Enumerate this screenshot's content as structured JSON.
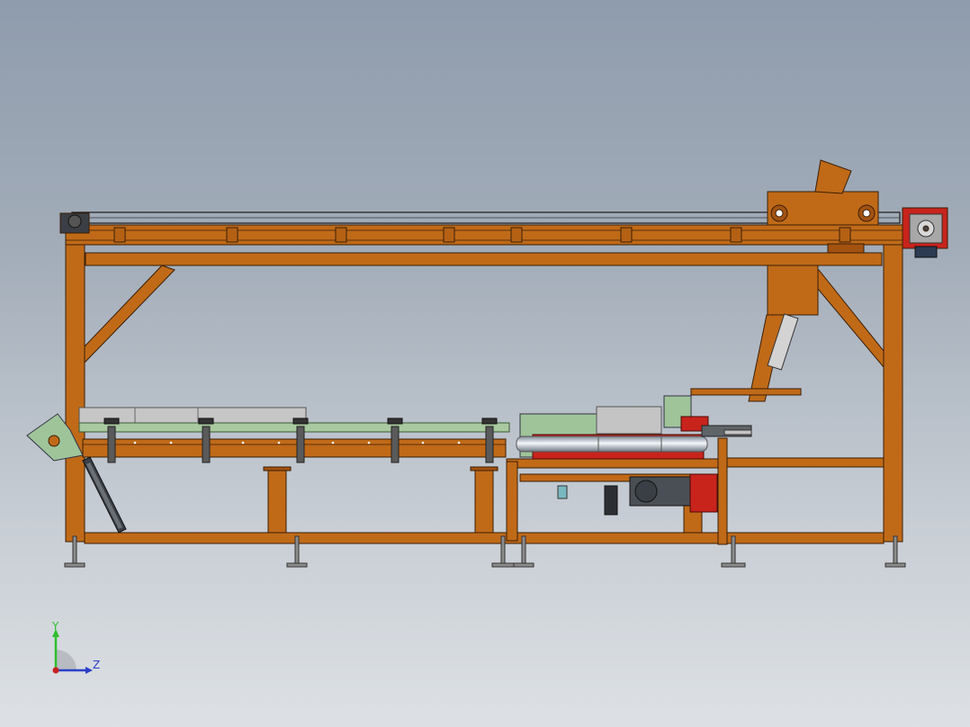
{
  "viewport": {
    "description_free": true
  },
  "triad": {
    "y_label": "Y",
    "z_label": "Z",
    "colors": {
      "y": "#2fbf2f",
      "z": "#2a3fc8",
      "x": "#c82020"
    }
  },
  "colors": {
    "frame": "#c06a18",
    "frame_edge": "#3a1e06",
    "panel_gray": "#c4c4c4",
    "panel_green": "#9fc49a",
    "rail_green": "#a9c9a0",
    "motor_gray": "#4a4f55",
    "red_accent": "#c8241c",
    "pipe_light": "#e8eef2"
  }
}
